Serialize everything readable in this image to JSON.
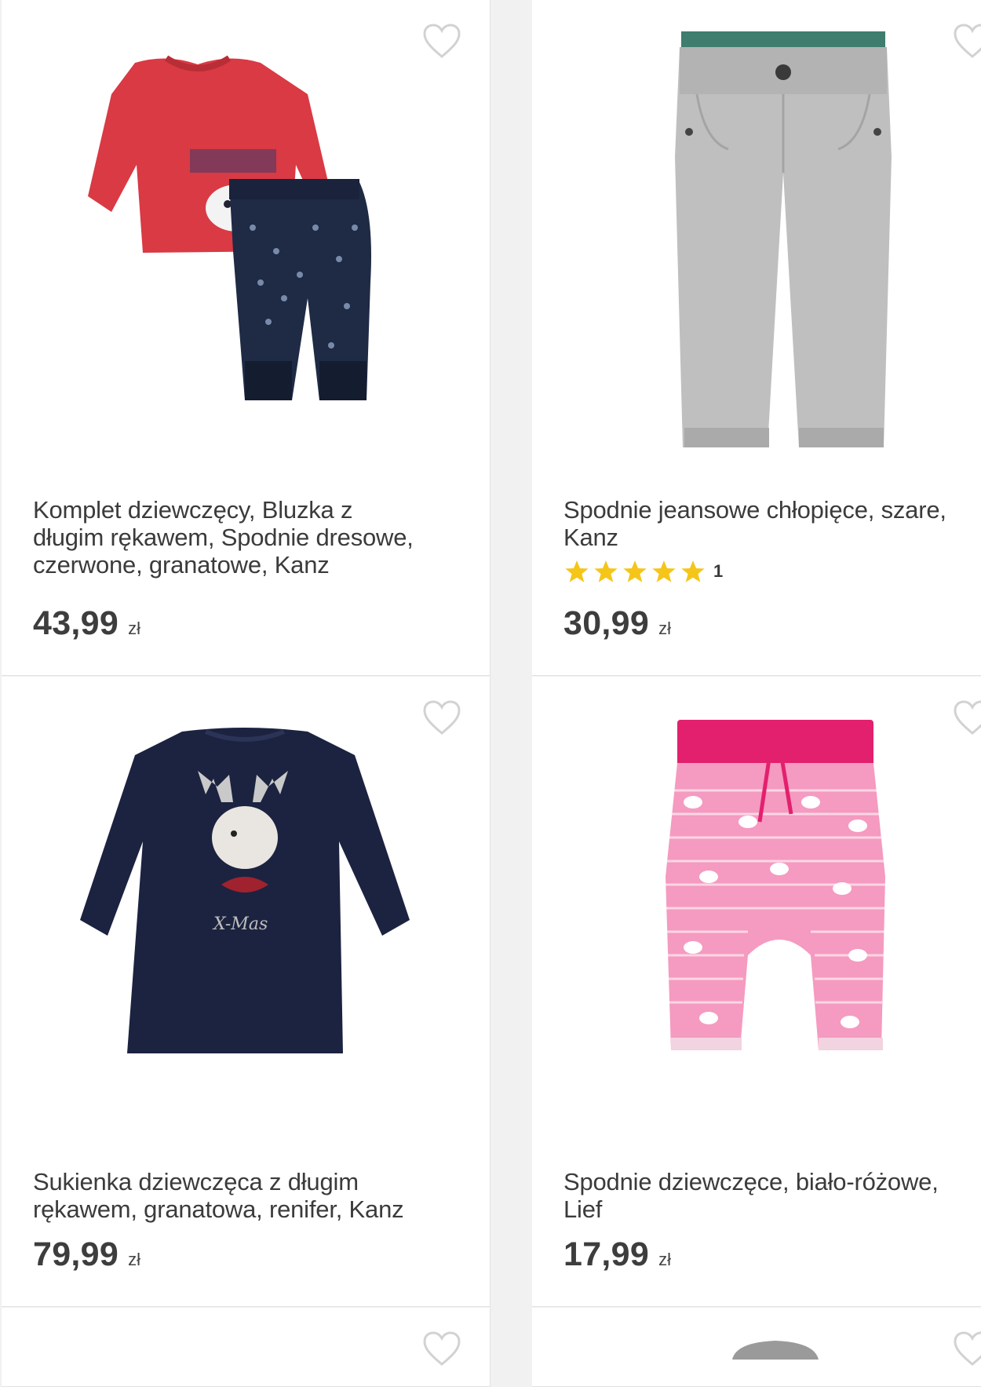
{
  "accent": {
    "star": "#f5c518",
    "heart": "#d2d2d2"
  },
  "products": [
    {
      "title": "Komplet dziewczęcy, Bluzka z\ndługim rękawem, Spodnie dresowe,\nczerwone, granatowe, Kanz",
      "price": "43,99",
      "currency": "zł",
      "favorite_icon": "heart-outline-icon"
    },
    {
      "title": "Spodnie jeansowe chłopięce, szare,\nKanz",
      "rating": {
        "stars": 5,
        "count": "1"
      },
      "price": "30,99",
      "currency": "zł",
      "favorite_icon": "heart-outline-icon"
    },
    {
      "title": "Sukienka dziewczęca z długim\nrękawem, granatowa, renifer, Kanz",
      "price": "79,99",
      "currency": "zł",
      "favorite_icon": "heart-outline-icon"
    },
    {
      "title": "Spodnie dziewczęce, biało-różowe,\nLief",
      "price": "17,99",
      "currency": "zł",
      "favorite_icon": "heart-outline-icon"
    }
  ]
}
